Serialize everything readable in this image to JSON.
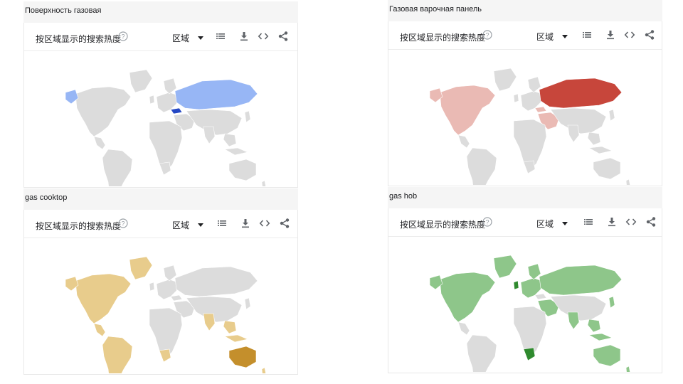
{
  "panels": [
    {
      "title": "Поверхность газовая",
      "heading": "按区域显示的搜索热度",
      "region_label": "区域",
      "colors": {
        "light": "#97b6f5",
        "dark": "#2548c4",
        "base": "#dcdcdc"
      }
    },
    {
      "title": "Газовая варочная панель",
      "heading": "按区域显示的搜索热度",
      "region_label": "区域",
      "colors": {
        "light": "#eabab4",
        "dark": "#c7463b",
        "base": "#dcdcdc"
      }
    },
    {
      "title": "gas cooktop",
      "heading": "按区域显示的搜索热度",
      "region_label": "区域",
      "colors": {
        "light": "#e8cc8c",
        "dark": "#c48f2c",
        "base": "#dcdcdc"
      }
    },
    {
      "title": "gas hob",
      "heading": "按区域显示的搜索热度",
      "region_label": "区域",
      "colors": {
        "light": "#8ec68a",
        "dark": "#2f8a2e",
        "base": "#dcdcdc"
      }
    }
  ],
  "icons": [
    "help-icon",
    "list-icon",
    "download-icon",
    "embed-icon",
    "share-icon",
    "caret-down-icon"
  ]
}
